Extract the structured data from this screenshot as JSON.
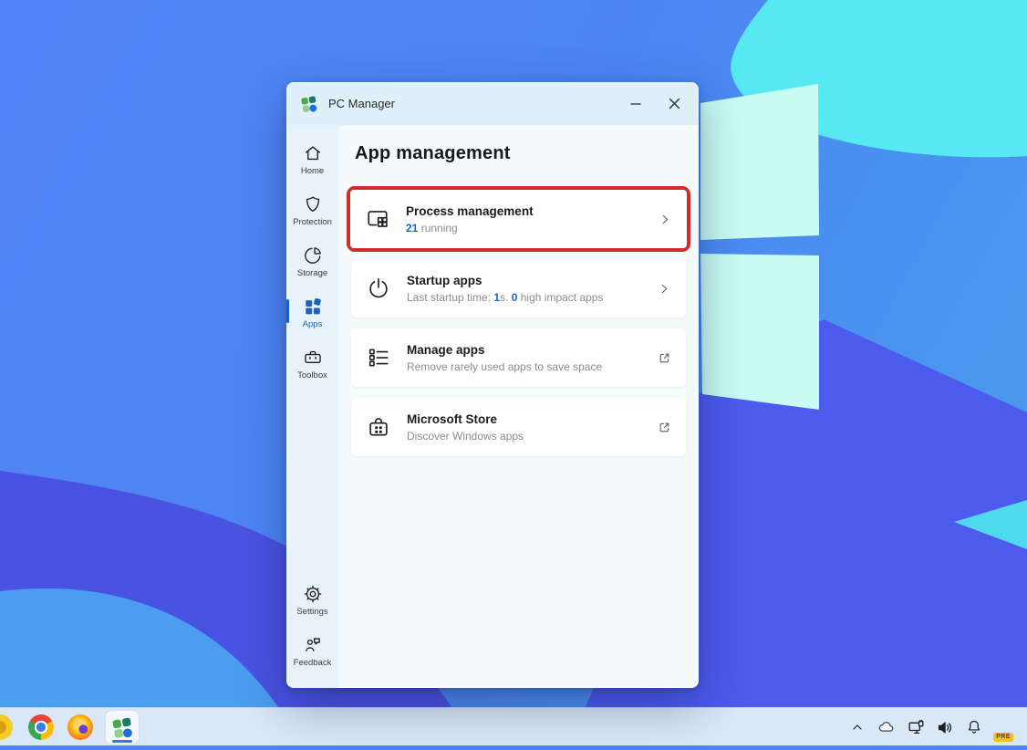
{
  "window": {
    "title": "PC Manager",
    "controls": {
      "minimize": "minimize-button",
      "close": "close-button"
    }
  },
  "sidebar": {
    "items": [
      {
        "label": "Home",
        "icon": "home-icon",
        "active": false
      },
      {
        "label": "Protection",
        "icon": "shield-icon",
        "active": false
      },
      {
        "label": "Storage",
        "icon": "storage-pie-icon",
        "active": false
      },
      {
        "label": "Apps",
        "icon": "apps-icon",
        "active": true
      },
      {
        "label": "Toolbox",
        "icon": "toolbox-icon",
        "active": false
      }
    ],
    "footer_items": [
      {
        "label": "Settings",
        "icon": "gear-icon"
      },
      {
        "label": "Feedback",
        "icon": "feedback-icon"
      }
    ]
  },
  "main": {
    "title": "App management",
    "cards": [
      {
        "title": "Process management",
        "count": "21",
        "count_suffix": " running",
        "trailing_icon": "chevron-right-icon",
        "highlighted": true
      },
      {
        "title": "Startup apps",
        "sub_p1": "Last startup time: ",
        "sub_v1": "1",
        "sub_p2": "s. ",
        "sub_v2": "0",
        "sub_p3": " high impact apps",
        "trailing_icon": "chevron-right-icon"
      },
      {
        "title": "Manage apps",
        "subtitle": "Remove rarely used apps to save space",
        "trailing_icon": "external-link-icon"
      },
      {
        "title": "Microsoft Store",
        "subtitle": "Discover Windows apps",
        "trailing_icon": "external-link-icon"
      }
    ]
  },
  "highlight": {
    "color": "#d22b2b"
  },
  "taskbar": {
    "pinned": [
      {
        "name": "chrome-canary",
        "partial": true
      },
      {
        "name": "chrome"
      },
      {
        "name": "firefox"
      },
      {
        "name": "pc-manager",
        "active": true
      }
    ],
    "tray": [
      "chevron-up",
      "onedrive-cloud",
      "network",
      "volume",
      "notifications-bell",
      "copilot"
    ],
    "copilot_badge": "PRE"
  },
  "colors": {
    "accent_blue": "#1a66c9",
    "nav_active_blue": "#1464c0",
    "highlight_red": "#d22b2b",
    "titlebar_bg": "#dff0fa",
    "sidebar_bg": "#e8f2fb",
    "content_bg": "#f5fafd",
    "taskbar_bg": "#d9e7f6",
    "wallpaper_base": "#4f83f5",
    "wallpaper_cyan": "#57e9f2",
    "wallpaper_mint": "#c9fcf2",
    "wallpaper_indigo": "#4b55e6"
  }
}
